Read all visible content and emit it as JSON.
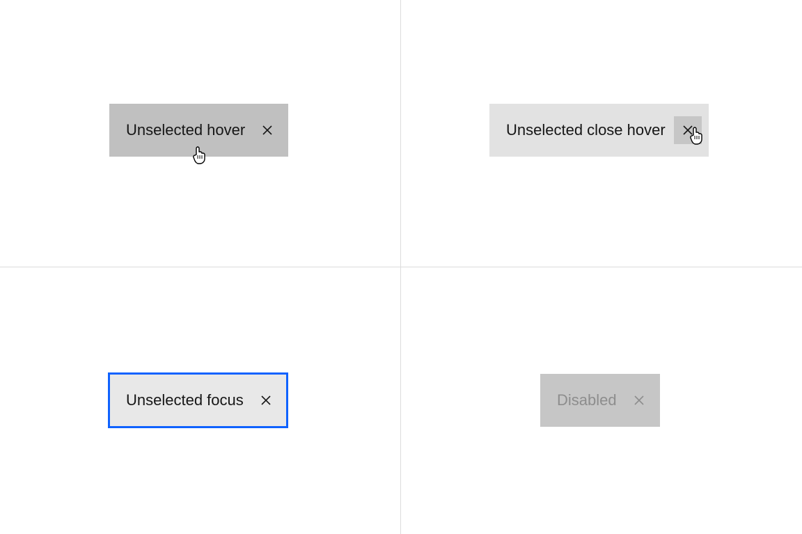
{
  "tabs": {
    "hover": {
      "label": "Unselected hover"
    },
    "close_hover": {
      "label": "Unselected close hover"
    },
    "focus": {
      "label": "Unselected focus"
    },
    "disabled": {
      "label": "Disabled"
    }
  },
  "colors": {
    "focus_outline": "#0f62fe",
    "hover_bg": "#c0c0c0",
    "light_bg": "#e2e2e2",
    "disabled_bg": "#c6c6c6",
    "disabled_text": "#8d8d8d"
  }
}
